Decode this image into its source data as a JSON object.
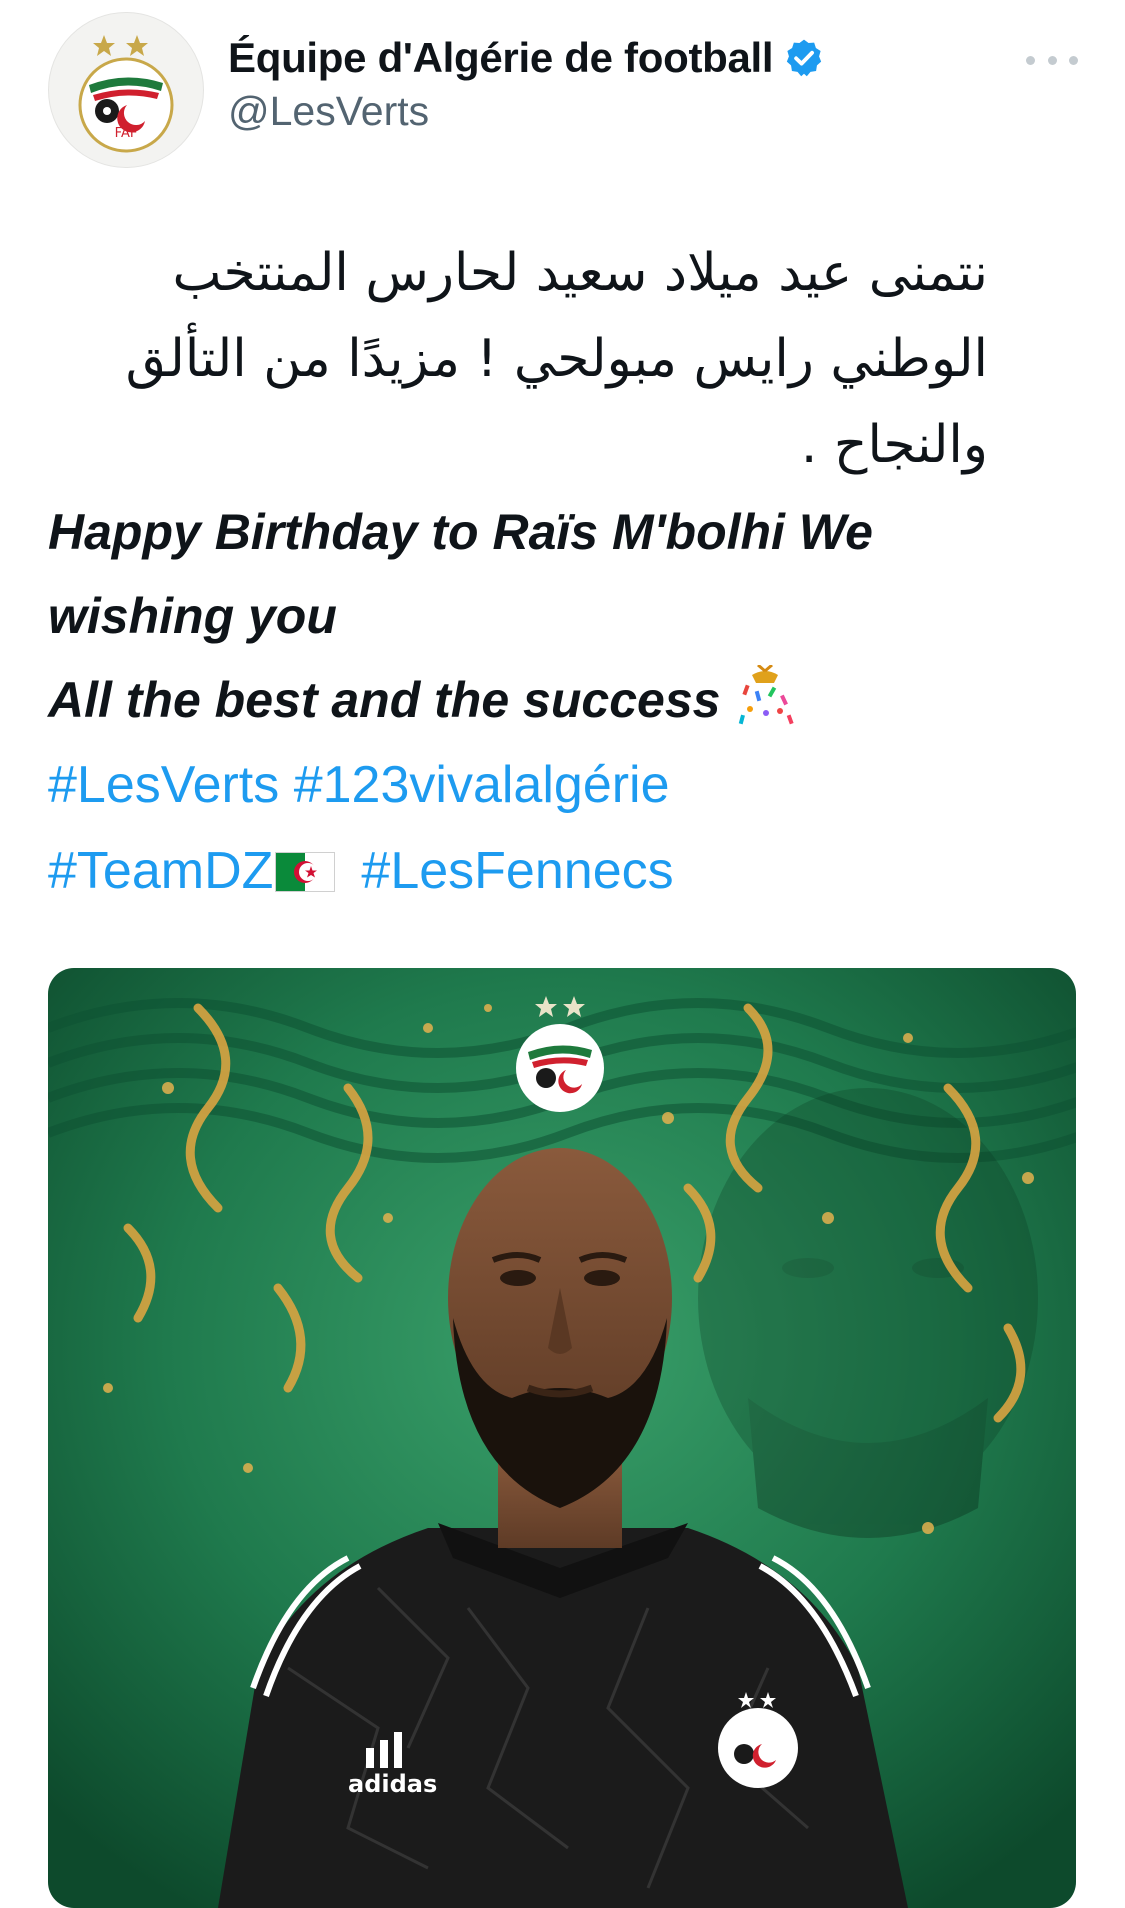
{
  "account": {
    "display_name": "Équipe d'Algérie de football",
    "handle": "@LesVerts",
    "verified": true,
    "avatar": "faf-crest-logo",
    "verified_icon": "verified-badge-icon",
    "more_icon": "more-dots-icon"
  },
  "tweet": {
    "arabic_lines": [
      "نتمنى عيد ميلاد سعيد لحارس المنتخب",
      "الوطني رايس مبولحي ! مزيدًا من التألق",
      "والنجاح ."
    ],
    "english_lines": [
      "Happy Birthday to Raïs M'bolhi We",
      "wishing you",
      "All the best and the success"
    ],
    "hashtags": [
      "#LesVerts",
      "#123vivalalgérie",
      "#TeamDZ",
      "#LesFennecs"
    ],
    "emoji": {
      "confetti": "confetti-ball-icon",
      "flag": "algeria-flag-icon"
    }
  },
  "media": {
    "description_icon": "birthday-graphic-photo"
  },
  "colors": {
    "link": "#1d9bf0",
    "text": "#0f1419",
    "secondary": "#536471",
    "verified": "#1d9bf0",
    "graphic_green": "#1f7a4d"
  }
}
